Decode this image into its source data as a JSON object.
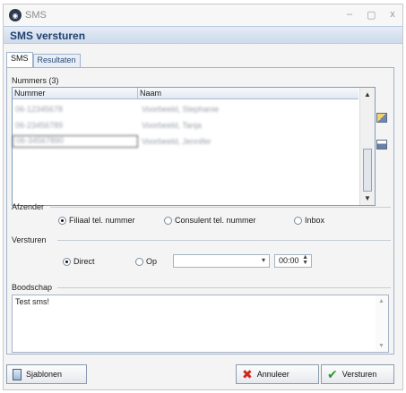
{
  "window": {
    "title": "SMS",
    "controls": [
      "–",
      "▢",
      "x"
    ]
  },
  "header": {
    "title": "SMS versturen"
  },
  "tabs": [
    {
      "label": "SMS",
      "active": true
    },
    {
      "label": "Resultaten",
      "active": false
    }
  ],
  "numbers": {
    "group_label": "Nummers (3)",
    "columns": [
      "Nummer",
      "Naam"
    ],
    "rows": [
      {
        "nummer": "06-12345678",
        "naam": "Voorbeeld, Stephanie"
      },
      {
        "nummer": "06-23456789",
        "naam": "Voorbeeld, Tanja"
      },
      {
        "nummer": "06-34567890",
        "naam": "Voorbeeld, Jennifer"
      }
    ]
  },
  "sender": {
    "group_label": "Afzender",
    "options": [
      {
        "label": "Filiaal tel. nummer",
        "checked": true
      },
      {
        "label": "Consulent tel. nummer",
        "checked": false
      },
      {
        "label": "Inbox",
        "checked": false
      }
    ]
  },
  "send": {
    "group_label": "Versturen",
    "options": [
      {
        "label": "Direct",
        "checked": true
      },
      {
        "label": "Op",
        "checked": false
      }
    ],
    "date_value": "",
    "time_value": "00:00"
  },
  "message": {
    "group_label": "Boodschap",
    "text": "Test sms!"
  },
  "buttons": {
    "templates": "Sjablonen",
    "cancel": "Annuleer",
    "send": "Versturen"
  },
  "colors": {
    "header_text": "#1f3f6e",
    "cancel_icon": "#d3261c",
    "send_icon": "#2e9a2e"
  },
  "icons": [
    "app-icon",
    "address-book-icon",
    "import-list-icon",
    "document-icon",
    "cross-icon",
    "checkmark-icon"
  ]
}
